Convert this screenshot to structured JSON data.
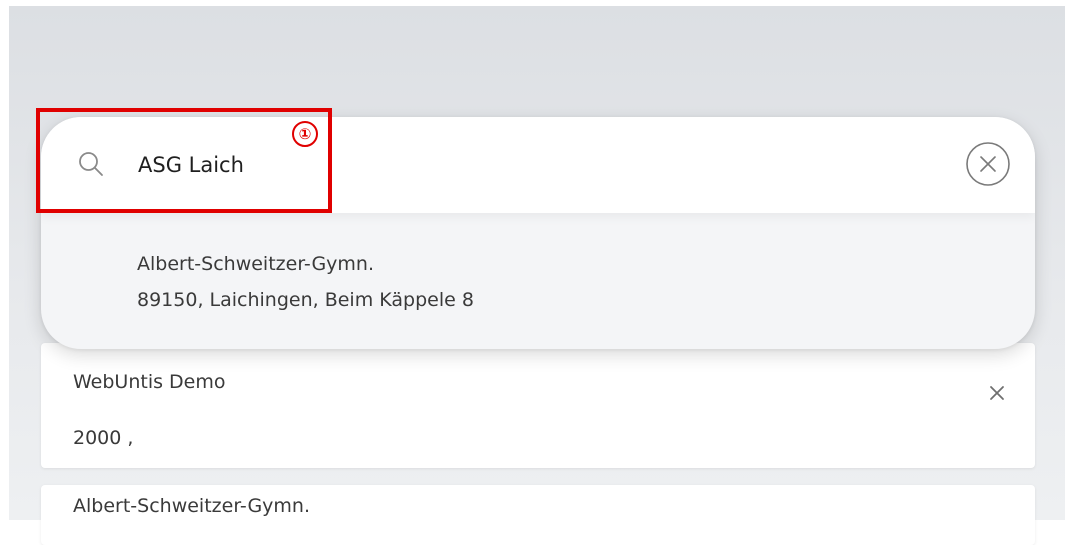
{
  "search": {
    "query": "ASG Laich",
    "placeholder": "",
    "search_icon": "search-icon",
    "clear_icon": "close-circle-icon"
  },
  "results": [
    {
      "name": "Albert-Schweitzer-Gymn.",
      "address": "89150, Laichingen, Beim Käppele 8"
    }
  ],
  "saved_schools": [
    {
      "name": "WebUntis Demo",
      "subtitle": "2000 ,",
      "remove_icon": "close-icon"
    },
    {
      "name": "Albert-Schweitzer-Gymn.",
      "subtitle": ""
    }
  ],
  "annotation": {
    "step": "①",
    "color": "#e00000"
  },
  "colors": {
    "background": "#e3e6e9",
    "card": "#ffffff",
    "popover": "#f4f5f7",
    "text": "#3a3a3a",
    "icon": "#8a8a8a"
  }
}
